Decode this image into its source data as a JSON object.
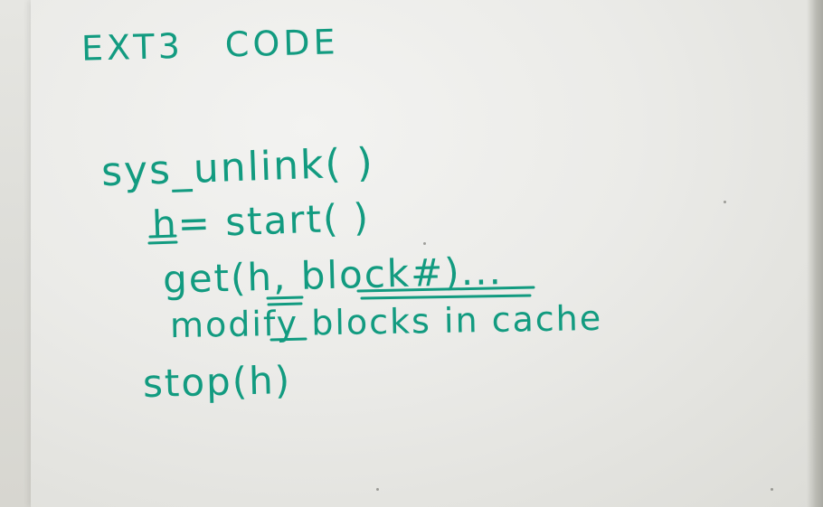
{
  "whiteboard": {
    "title": "EXT3   CODE",
    "lines": [
      "sys_unlink( )",
      "h= start( )",
      "get(h, block#)...",
      "modify blocks in cache",
      "stop(h)"
    ],
    "ink_color": "#129b80"
  }
}
